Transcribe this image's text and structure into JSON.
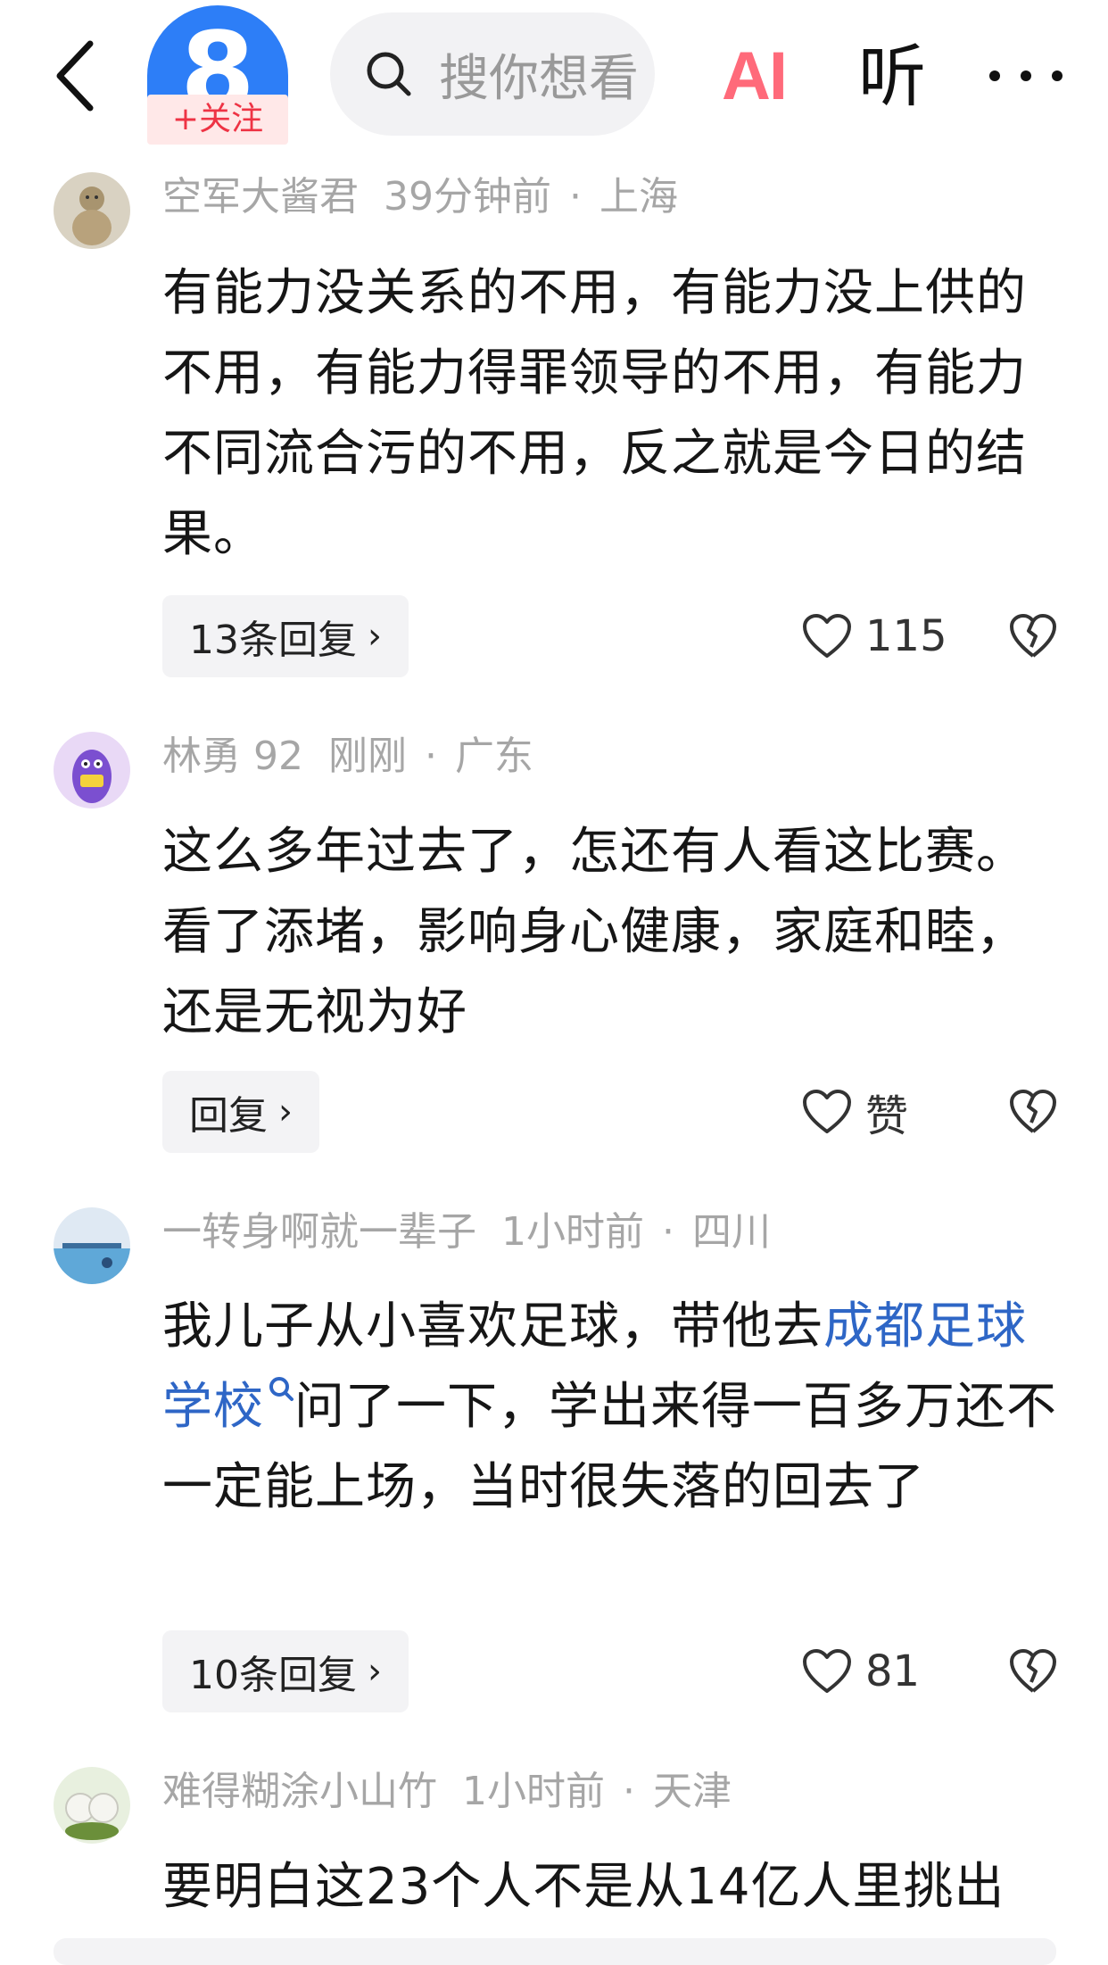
{
  "header": {
    "avatar_digit": "8",
    "follow_label": "+关注",
    "search_placeholder": "搜你想看",
    "ai_label": "AI",
    "listen_label": "听"
  },
  "comments": [
    {
      "username": "空军大酱君",
      "time": "39分钟前",
      "location": "上海",
      "text": "有能力没关系的不用，有能力没上供的不用，有能力得罪领导的不用，有能力不同流合污的不用，反之就是今日的结果。",
      "reply_label": "13条回复",
      "likes": "115"
    },
    {
      "username": "林勇 92",
      "time": "刚刚",
      "location": "广东",
      "text": "这么多年过去了，怎还有人看这比赛。看了添堵，影响身心健康，家庭和睦，还是无视为好",
      "reply_label": "回复",
      "likes": "赞"
    },
    {
      "username": "一转身啊就一辈子",
      "time": "1小时前",
      "location": "四川",
      "text_before": "我儿子从小喜欢足球，带他去",
      "link_text": "成都足球学校",
      "text_after": "问了一下，学出来得一百多万还不一定能上场，当时很失落的回去了",
      "reply_label": "10条回复",
      "likes": "81"
    },
    {
      "username": "难得糊涂小山竹",
      "time": "1小时前",
      "location": "天津",
      "text": "要明白这23个人不是从14亿人里挑出"
    }
  ]
}
